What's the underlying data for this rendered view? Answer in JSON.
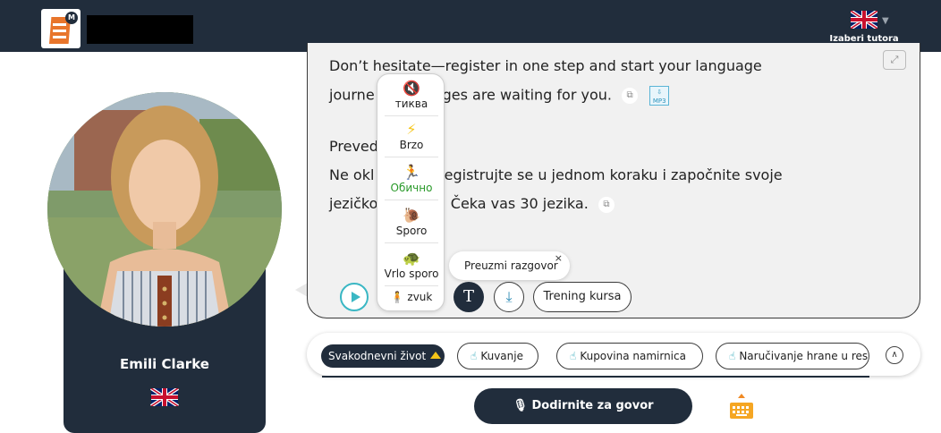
{
  "header": {
    "tutor_select_label": "Izaberi tutora",
    "logo_badge": "M"
  },
  "tutor": {
    "name": "Emili Clarke"
  },
  "chat": {
    "line1": "Don’t hesitate—register in one step and start your language",
    "line2a": "journe",
    "line2b": "uages are waiting for you.",
    "line3": "Preved",
    "line4a": "Ne okl",
    "line4b": "registrujte se u jednom koraku i započnite svoje",
    "line5a": "jezičko",
    "line5b": "e! Čeka vas 30 jezika.",
    "copy_glyph": "⧉",
    "mp3_label": "MP3"
  },
  "speed_menu": {
    "items": [
      {
        "label": "тиква",
        "icon": "🔇"
      },
      {
        "label": "Brzo",
        "icon": "⚡"
      },
      {
        "label": "Обично",
        "icon": "🏃"
      },
      {
        "label": "Sporo",
        "icon": "🐌"
      },
      {
        "label": "Vrlo sporo",
        "icon": "🐢"
      },
      {
        "label": "zvuk",
        "icon": "🧍"
      }
    ],
    "active_color": "#2a9a2a"
  },
  "controls": {
    "t_glyph": "T",
    "download_glyph": "⤓",
    "training_label": "Trening kursa",
    "tooltip": "Preuzmi razgovor",
    "tooltip_close": "×"
  },
  "categories": {
    "active": "Svakodnevni život",
    "chips": [
      "Kuvanje",
      "Kupovina namirnica",
      "Naručivanje hrane u resi"
    ],
    "collapse_glyph": "∧"
  },
  "speak": {
    "label": "Dodirnite za govor",
    "mic_glyph": "🎙"
  },
  "colors": {
    "navy": "#212d3c",
    "accent_teal": "#3ab7c4",
    "keyboard_orange": "#f5a623"
  }
}
